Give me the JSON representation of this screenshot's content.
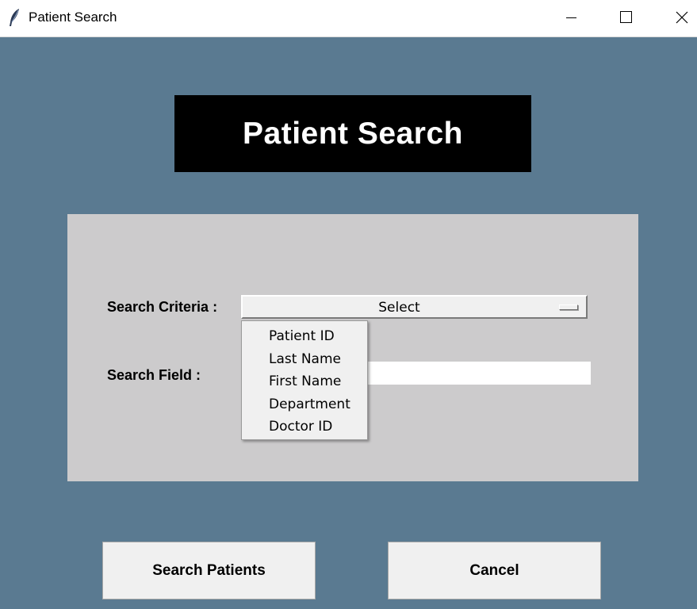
{
  "window": {
    "title": "Patient Search",
    "app_icon": "feather-icon",
    "controls": [
      "minimize-icon",
      "maximize-icon",
      "close-icon"
    ]
  },
  "header": {
    "title": "Patient Search"
  },
  "form": {
    "criteria_label": "Search Criteria :",
    "criteria_selected": "Select",
    "field_label": "Search Field :",
    "field_value": ""
  },
  "dropdown": {
    "open": true,
    "options": [
      "Patient ID",
      "Last Name",
      "First Name",
      "Department",
      "Doctor ID"
    ]
  },
  "actions": {
    "search_label": "Search Patients",
    "cancel_label": "Cancel"
  },
  "colors": {
    "background": "#5a7a91",
    "panel": "#cccbcc",
    "header_bg": "#000000",
    "header_text": "#ffffff"
  }
}
